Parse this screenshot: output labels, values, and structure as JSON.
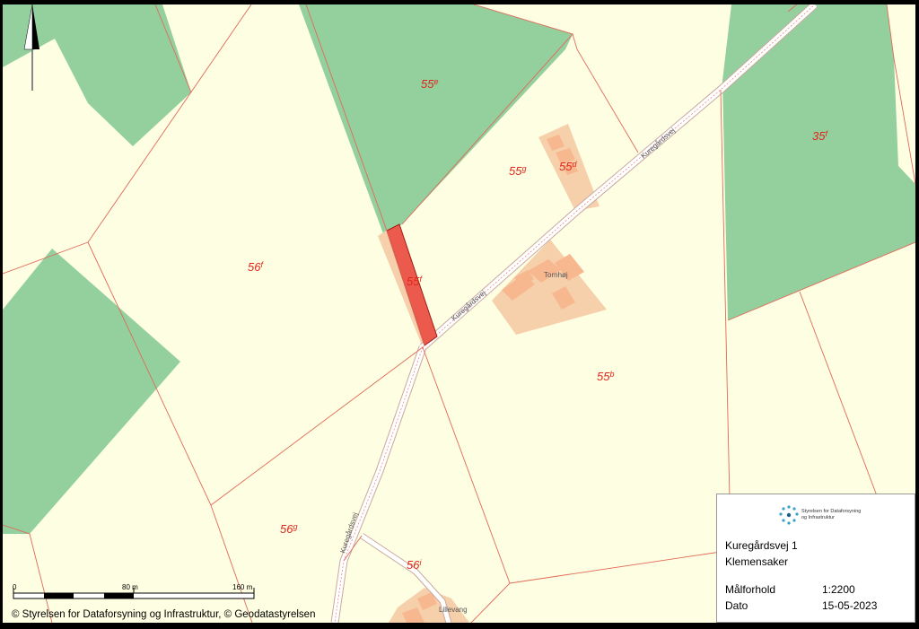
{
  "map": {
    "parcels": [
      {
        "id": "55e",
        "num": "55",
        "sup": "e"
      },
      {
        "id": "35f",
        "num": "35",
        "sup": "f"
      },
      {
        "id": "55g",
        "num": "55",
        "sup": "g"
      },
      {
        "id": "55d",
        "num": "55",
        "sup": "d"
      },
      {
        "id": "56f",
        "num": "56",
        "sup": "f"
      },
      {
        "id": "55f",
        "num": "55",
        "sup": "f"
      },
      {
        "id": "55b",
        "num": "55",
        "sup": "b"
      },
      {
        "id": "56g",
        "num": "56",
        "sup": "g"
      },
      {
        "id": "56i",
        "num": "56",
        "sup": "i"
      }
    ],
    "roads": [
      "Kuregårdsvej",
      "Kuregårdsvej",
      "Kuregårdsvej"
    ],
    "places": [
      "Tornhøj",
      "Lillevang"
    ],
    "colors": {
      "background": "#fefee2",
      "forest": "#94d09e",
      "boundary": "#e06a5a",
      "selected_parcel": "#ec5a4e",
      "buildings": "#f8b88f",
      "yard": "#f6cfab",
      "road": "#ffffff"
    }
  },
  "scale_bar": {
    "labels": [
      "0",
      "80 m",
      "160 m"
    ]
  },
  "copyright": "© Styrelsen for Dataforsyning og Infrastruktur, © Geodatastyrelsen",
  "legend": {
    "logo_line1": "Styrelsen for Dataforsyning",
    "logo_line2": "og Infrastruktur",
    "address_line1": "Kuregårdsvej 1",
    "address_line2": "Klemensaker",
    "scale_key": "Målforhold",
    "scale_value": "1:2200",
    "date_key": "Dato",
    "date_value": "15-05-2023"
  }
}
